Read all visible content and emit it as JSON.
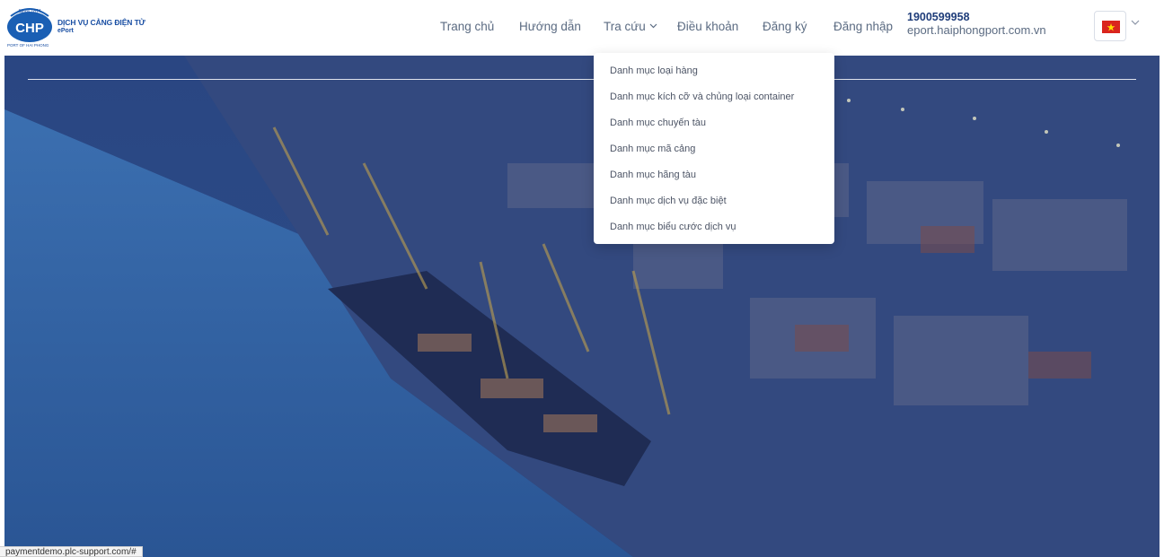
{
  "logo": {
    "badge_top": "Since 1874",
    "badge_text": "CHP",
    "title": "DỊCH VỤ CẢNG ĐIỆN TỬ",
    "subtitle": "ePort",
    "footer": "PORT OF HAI PHONG"
  },
  "nav": {
    "items": [
      {
        "label": "Trang chủ"
      },
      {
        "label": "Hướng dẫn"
      },
      {
        "label": "Tra cứu"
      },
      {
        "label": "Điều khoản"
      },
      {
        "label": "Đăng ký"
      },
      {
        "label": "Đăng nhập"
      }
    ]
  },
  "contact": {
    "phone": "1900599958",
    "website": "eport.haiphongport.com.vn"
  },
  "language": {
    "flag": "vietnam-flag-icon",
    "flag_color": "#da251d",
    "star_color": "#ffde00"
  },
  "dropdown": {
    "items": [
      "Danh mục loại hàng",
      "Danh mục kích cỡ và chủng loại container",
      "Danh mục chuyến tàu",
      "Danh mục mã cảng",
      "Danh mục hãng tàu",
      "Danh mục dịch vụ đặc biệt",
      "Danh mục biểu cước dịch vụ"
    ]
  },
  "statusbar": {
    "url": "paymentdemo.plc-support.com/#"
  },
  "colors": {
    "brand": "#1a4fa3",
    "nav_text": "#5b6b82",
    "hero_overlay": "#2a4682"
  }
}
